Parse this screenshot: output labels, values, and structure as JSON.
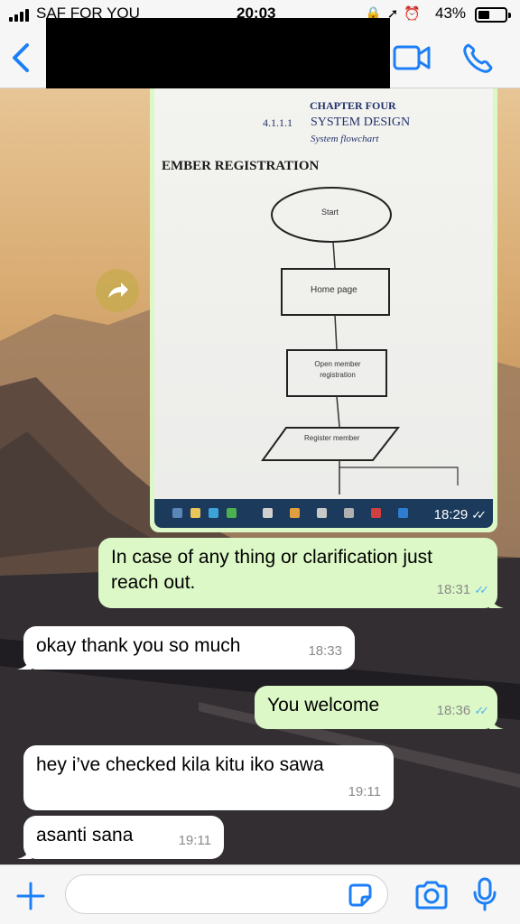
{
  "status_bar": {
    "carrier": "SAF FOR YOU",
    "time": "20:03",
    "status_icons": [
      "lock-rotation-icon",
      "location-arrow-icon",
      "alarm-icon"
    ],
    "battery_percent_label": "43%",
    "battery_level": 0.43
  },
  "header": {
    "back_icon": "chevron-left-icon",
    "video_icon": "video-camera-icon",
    "call_icon": "phone-icon",
    "accent_color": "#1d7ff7"
  },
  "image_message": {
    "document": {
      "chapter": "CHAPTER FOUR",
      "section_number": "4.1.1.1",
      "section_title": "SYSTEM DESIGN",
      "subtitle": "System flowchart",
      "heading": "EMBER REGISTRATION",
      "flowchart": [
        "Start",
        "Home page",
        "Open member registration",
        "Register member"
      ]
    },
    "time": "18:29",
    "read": true
  },
  "messages": [
    {
      "direction": "out",
      "text": "In case of any thing or clarification just reach out.",
      "time": "18:31",
      "read": true
    },
    {
      "direction": "in",
      "text": "okay thank you so much",
      "time": "18:33"
    },
    {
      "direction": "out",
      "text": "You welcome",
      "time": "18:36",
      "read": true
    },
    {
      "direction": "in",
      "text": "hey i’ve checked kila kitu iko sawa",
      "time": "19:11"
    },
    {
      "direction": "in",
      "text": "asanti sana",
      "time": "19:11"
    }
  ],
  "input_bar": {
    "placeholder": "",
    "icons": [
      "plus-icon",
      "sticker-icon",
      "camera-icon",
      "microphone-icon"
    ]
  },
  "colors": {
    "outgoing_bubble": "#dcf8c6",
    "incoming_bubble": "#ffffff",
    "read_ticks": "#4fb6ec"
  }
}
